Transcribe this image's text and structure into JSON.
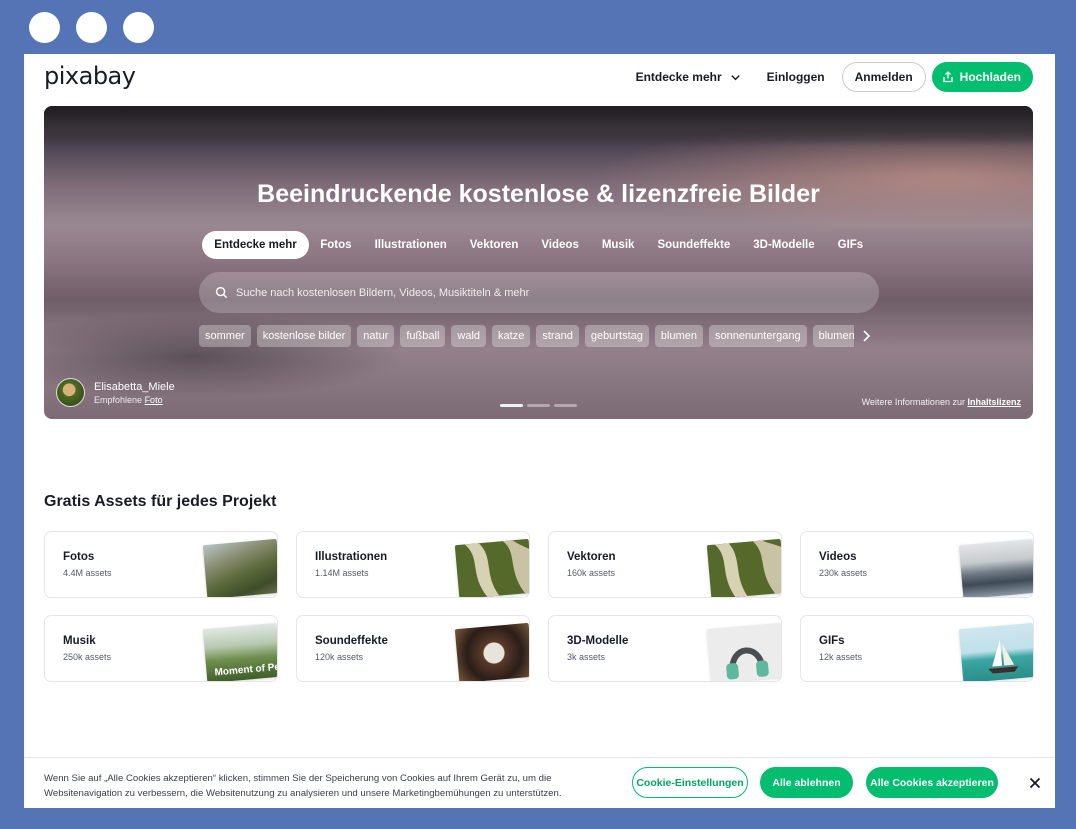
{
  "header": {
    "logo": "pixabay",
    "explore_label": "Entdecke mehr",
    "login_label": "Einloggen",
    "signup_label": "Anmelden",
    "upload_label": "Hochladen"
  },
  "hero": {
    "title": "Beeindruckende kostenlose & lizenzfreie Bilder",
    "tabs": [
      "Entdecke mehr",
      "Fotos",
      "Illustrationen",
      "Vektoren",
      "Videos",
      "Musik",
      "Soundeffekte",
      "3D-Modelle",
      "GIFs"
    ],
    "search_placeholder": "Suche nach kostenlosen Bildern, Videos, Musiktiteln & mehr",
    "chips": [
      "sommer",
      "kostenlose bilder",
      "natur",
      "fußball",
      "wald",
      "katze",
      "strand",
      "geburtstag",
      "blumen",
      "sonnenuntergang",
      "blumen"
    ],
    "author_name": "Elisabetta_Miele",
    "author_sub_prefix": "Empfohlene",
    "author_sub_link": "Foto",
    "license_prefix": "Weitere Informationen zur",
    "license_link": "Inhaltslizenz",
    "carousel_active_index": 0,
    "carousel_count": 3
  },
  "assets": {
    "title": "Gratis Assets für jedes Projekt",
    "cards": [
      {
        "title": "Fotos",
        "count": "4.4M assets",
        "icon": "photo-thumbnail"
      },
      {
        "title": "Illustrationen",
        "count": "1.14M assets",
        "icon": "illustration-thumbnail"
      },
      {
        "title": "Vektoren",
        "count": "160k assets",
        "icon": "vector-thumbnail"
      },
      {
        "title": "Videos",
        "count": "230k assets",
        "icon": "video-thumbnail"
      },
      {
        "title": "Musik",
        "count": "250k assets",
        "icon": "music-thumbnail"
      },
      {
        "title": "Soundeffekte",
        "count": "120k assets",
        "icon": "sound-effect-thumbnail"
      },
      {
        "title": "3D-Modelle",
        "count": "3k assets",
        "icon": "3d-model-thumbnail"
      },
      {
        "title": "GIFs",
        "count": "12k assets",
        "icon": "gif-thumbnail"
      }
    ],
    "music_thumb_text": "Moment of Pe"
  },
  "cookie": {
    "text": "Wenn Sie auf „Alle Cookies akzeptieren“ klicken, stimmen Sie der Speicherung von Cookies auf Ihrem Gerät zu, um die Websitenavigation zu verbessern, die Websitenutzung zu analysieren und unsere Marketingbemühungen zu unterstützen.",
    "settings_label": "Cookie-Einstellungen",
    "reject_label": "Alle ablehnen",
    "accept_label": "Alle Cookies akzeptieren"
  },
  "colors": {
    "brand_green": "#02be6e",
    "frame_blue": "#5474b6"
  }
}
